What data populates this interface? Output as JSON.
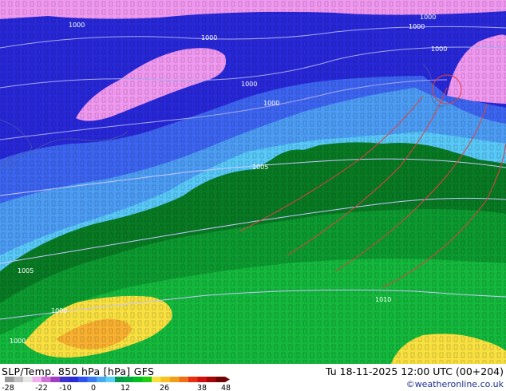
{
  "title": "SLP/Temp. 850 hPa [hPa] GFS",
  "datetime": "Tu 18-11-2025 12:00 UTC (00+204)",
  "credit": "©weatheronline.co.uk",
  "colorbar": {
    "ticks": [
      "-28",
      "-22",
      "-10",
      "0",
      "12",
      "26",
      "38",
      "48"
    ],
    "colors": [
      "#9a9a9a",
      "#c0c0c0",
      "#e6e6e6",
      "#f0aef0",
      "#d070d8",
      "#a040c0",
      "#4030d0",
      "#2a2ad8",
      "#3050f0",
      "#3a7cf0",
      "#48a8f0",
      "#58d0f8",
      "#009a4a",
      "#00aa3a",
      "#00c020",
      "#20d010",
      "#f8e040",
      "#f8c020",
      "#f0a018",
      "#f07018",
      "#e83010",
      "#d01010",
      "#a00808",
      "#700404"
    ]
  },
  "map": {
    "isobar_labels": [
      "1000",
      "1000",
      "1000",
      "1000",
      "1000",
      "1000",
      "1000",
      "1005",
      "1005",
      "1000",
      "1000",
      "1010"
    ],
    "colors": {
      "cold_pink": "#f098f0",
      "deep_blue": "#2828d8",
      "mid_blue": "#3c64f0",
      "light_blue": "#4c9cf4",
      "cyan": "#58c8f8",
      "dark_green": "#087a24",
      "green": "#0c9a30",
      "bright_green": "#14b83c",
      "yellow": "#f8e040",
      "orange": "#f8b030"
    }
  }
}
